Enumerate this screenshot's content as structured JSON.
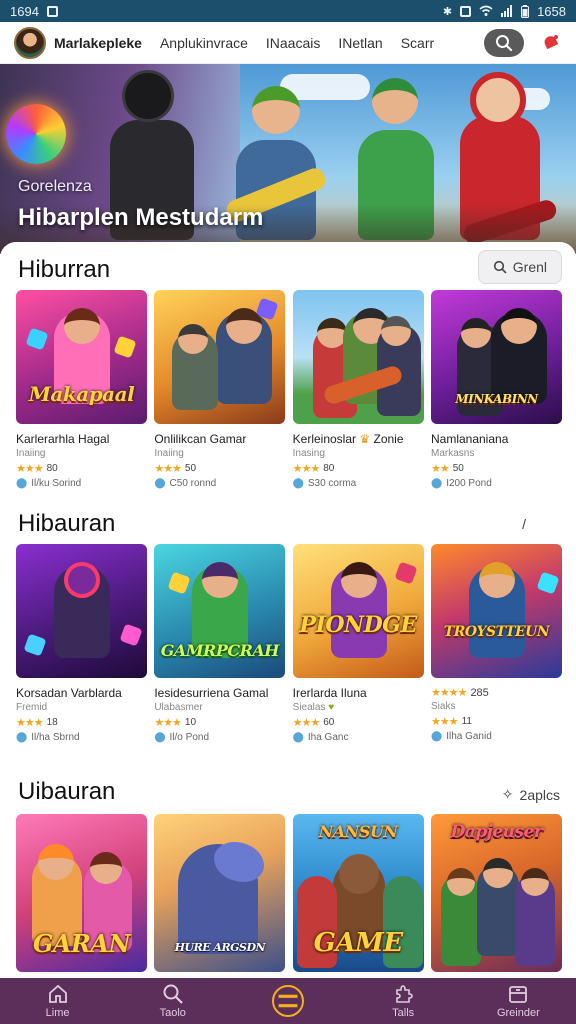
{
  "status_bar": {
    "time_left": "1694",
    "time_right": "1658"
  },
  "header": {
    "brand": "Marlakepleke",
    "nav": [
      "Anplukinvrace",
      "INaacais",
      "INetlan",
      "Scarr"
    ],
    "icons": {
      "search": "search-icon",
      "notification": "bell-icon"
    }
  },
  "hero": {
    "subtitle": "Gorelenza",
    "title": "Hibarplen Mestudarm"
  },
  "sections": [
    {
      "title": "Hiburran",
      "action_label": "Grenl",
      "cards": [
        {
          "title": "Karlerarhla Hagal",
          "sub": "Inaiing",
          "stars": "★★★",
          "rating": "80",
          "meta": "Il/ku Sorind",
          "overlay": "Makapaal",
          "accent": "#c3276f"
        },
        {
          "title": "Onlilikcan Gamar",
          "sub": "Inaiing",
          "stars": "★★★",
          "rating": "50",
          "meta": "C50 ronnd",
          "overlay": "",
          "accent": "#e79a2f"
        },
        {
          "title": "Kerleinoslar",
          "title_tag": "Zonie",
          "sub": "Inasing",
          "stars": "★★★",
          "rating": "80",
          "meta": "S30 corma",
          "overlay": "",
          "accent": "#3a9ad9"
        },
        {
          "title": "Namlananiana",
          "sub": "Markasns",
          "stars": "★★",
          "rating": "50",
          "meta": "I200 Pond",
          "overlay": "MINKABINN",
          "accent": "#8a2fb0"
        }
      ]
    },
    {
      "title": "Hibauran",
      "action_label": "/",
      "cards": [
        {
          "title": "Korsadan Varblarda",
          "sub": "Fremid",
          "stars": "★★★",
          "rating": "18",
          "meta": "Il/ha Sbrnd",
          "overlay": "",
          "accent": "#5b2a8e"
        },
        {
          "title": "Iesidesurriena Gamal",
          "sub": "Ulabasmer",
          "stars": "★★★",
          "rating": "10",
          "meta": "Il/o Pond",
          "overlay": "GAMRPCRAH",
          "accent": "#2fa6a6"
        },
        {
          "title": "Irerlarda Iluna",
          "sub": "Siealas",
          "stars": "★★★",
          "rating": "60",
          "meta": "Iha Ganc",
          "overlay": "PIONDGE",
          "accent": "#e6a52a"
        },
        {
          "title": "",
          "sub": "Siaks",
          "stars": "★★★★",
          "rating": "285",
          "meta": "Ilha Ganid",
          "meta_rating": "11",
          "overlay": "TROYSTTEUN",
          "accent": "#2b4fa8"
        }
      ]
    },
    {
      "title": "Uibauran",
      "action_label": "2aplcs",
      "cards": [
        {
          "overlay": "GARAN",
          "accent": "#d2417a"
        },
        {
          "overlay": "HURE ARGSDN",
          "accent": "#3d4f8a"
        },
        {
          "overlay": "GAME",
          "accent": "#2a86c9"
        },
        {
          "overlay": "Dapjeuser",
          "accent": "#d9672a"
        }
      ]
    }
  ],
  "bottom_nav": [
    {
      "label": "Lime",
      "icon": "home-icon"
    },
    {
      "label": "Taolo",
      "icon": "search-icon"
    },
    {
      "label": "",
      "icon": "menu-circle-icon"
    },
    {
      "label": "Talls",
      "icon": "puzzle-icon"
    },
    {
      "label": "Greinder",
      "icon": "archive-icon"
    }
  ]
}
